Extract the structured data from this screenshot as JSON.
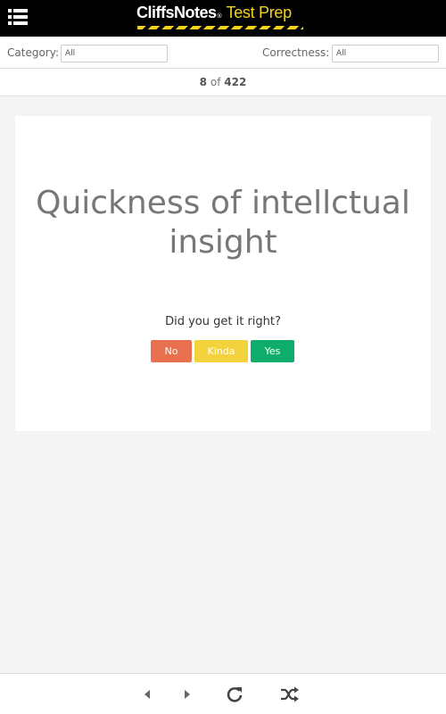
{
  "app": {
    "brand": "CliffsNotes",
    "registered_mark": "®",
    "product": "Test Prep",
    "colors": {
      "header_bg": "#000000",
      "brand_yellow": "#f3d21b"
    }
  },
  "header": {
    "menu_icon": "list-menu-icon"
  },
  "filters": {
    "category_label": "Category:",
    "category_value": "All",
    "correctness_label": "Correctness:",
    "correctness_value": "All"
  },
  "progress": {
    "current": "8",
    "separator": "of",
    "total": "422"
  },
  "card": {
    "term": "Quickness of intellctual insight",
    "question": "Did you get it right?",
    "buttons": {
      "no": {
        "label": "No",
        "color": "#e8704f"
      },
      "kinda": {
        "label": "Kinda",
        "color": "#f3d33b"
      },
      "yes": {
        "label": "Yes",
        "color": "#0fad6b"
      }
    }
  },
  "footer": {
    "icons": [
      "caret-left-icon",
      "caret-right-icon",
      "refresh-icon",
      "shuffle-icon"
    ]
  }
}
